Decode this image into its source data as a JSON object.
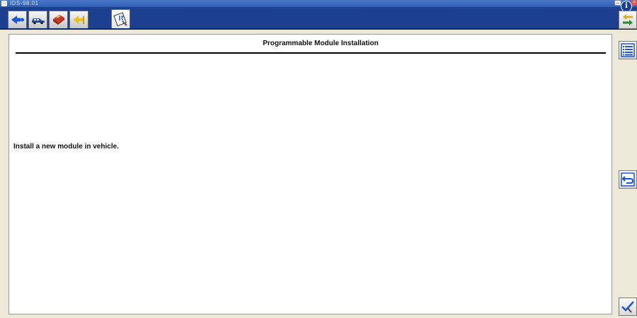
{
  "window": {
    "title": "IDS-98.01"
  },
  "toolbar": {
    "tabs": [
      {
        "icon": "arrow-left-icon",
        "label": "back"
      },
      {
        "icon": "vehicle-icon",
        "label": "vehicle"
      },
      {
        "icon": "toolbox-icon",
        "label": "toolbox"
      },
      {
        "icon": "arrow-yellow-icon",
        "label": "exit"
      },
      {
        "icon": "module-install-icon",
        "label": "active",
        "active": true
      }
    ]
  },
  "main": {
    "page_title": "Programmable Module Installation",
    "instruction": "Install a new module in vehicle."
  },
  "sidebar": {
    "buttons": [
      {
        "icon": "swap-arrows-icon"
      },
      {
        "icon": "list-icon"
      },
      {
        "icon": "return-icon"
      },
      {
        "icon": "check-tool-icon"
      }
    ]
  },
  "colors": {
    "toolbar_bg": "#1d3f8f",
    "accent_blue": "#1a56d0",
    "chrome_bg": "#ece9d8",
    "content_bg": "#ffffff"
  }
}
